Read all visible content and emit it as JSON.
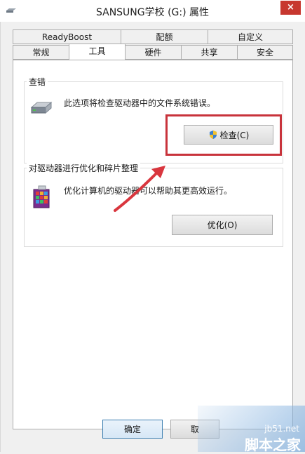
{
  "window": {
    "title": "SANSUNG学校 (G:) 属性",
    "close_label": "×"
  },
  "tabs_row1": [
    "ReadyBoost",
    "配额",
    "自定义"
  ],
  "tabs_row2": [
    "常规",
    "工具",
    "硬件",
    "共享",
    "安全"
  ],
  "active_tab": "工具",
  "error_check": {
    "group_title": "查错",
    "description": "此选项将检查驱动器中的文件系统错误。",
    "button_label": "检查(C)"
  },
  "optimize": {
    "group_title": "对驱动器进行优化和碎片整理",
    "description": "优化计算机的驱动器可以帮助其更高效运行。",
    "button_label": "优化(O)"
  },
  "footer": {
    "ok_label": "确定",
    "cancel_label": "取"
  },
  "watermark": {
    "site": "jb51.net",
    "name": "脚本之家"
  },
  "colors": {
    "highlight": "#c8333b",
    "arrow": "#d9363e",
    "close": "#c7372f"
  }
}
